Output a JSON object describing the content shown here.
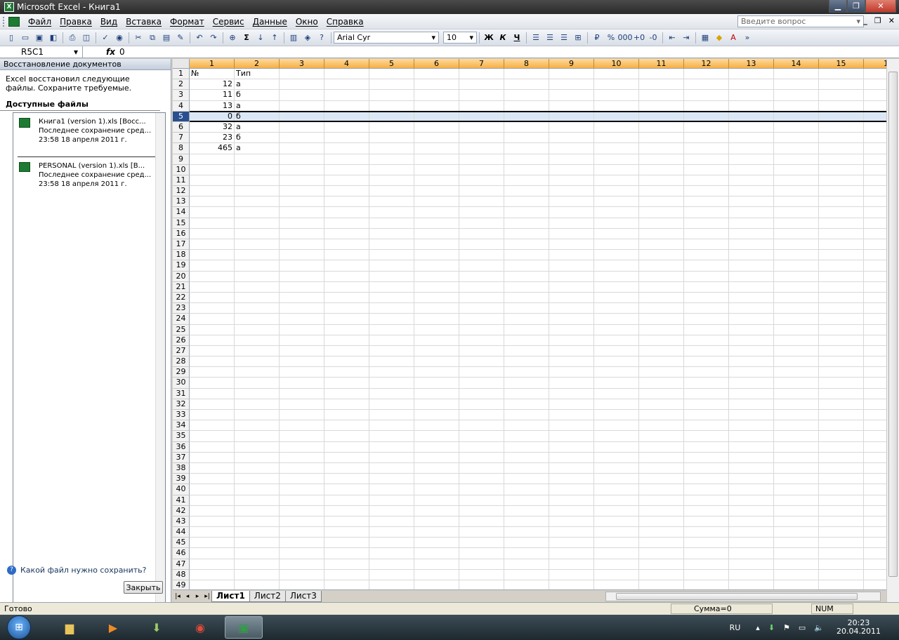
{
  "window": {
    "title": "Microsoft Excel - Книга1",
    "app_icon": "X"
  },
  "menu": {
    "items": [
      "Файл",
      "Правка",
      "Вид",
      "Вставка",
      "Формат",
      "Сервис",
      "Данные",
      "Окно",
      "Справка"
    ],
    "ask_placeholder": "Введите вопрос"
  },
  "toolbar": {
    "font": "Arial Cyr",
    "size": "10",
    "bold": "Ж",
    "italic": "К",
    "underline": "Ч"
  },
  "formula": {
    "cell_ref": "R5C1",
    "fx": "fx",
    "value": "0"
  },
  "taskpane": {
    "title": "Восстановление документов",
    "message": "Excel восстановил следующие файлы. Сохраните требуемые.",
    "available_label": "Доступные файлы",
    "files": [
      {
        "name": "Книга1 (version 1).xls  [Восс...",
        "saved": "Последнее сохранение сред...",
        "time": "23:58 18 апреля 2011 г."
      },
      {
        "name": "PERSONAL (version 1).xls  [В...",
        "saved": "Последнее сохранение сред...",
        "time": "23:58 18 апреля 2011 г."
      }
    ],
    "help_link": "Какой файл нужно сохранить?",
    "close_button": "Закрыть"
  },
  "sheet": {
    "columns": [
      "1",
      "2",
      "3",
      "4",
      "5",
      "6",
      "7",
      "8",
      "9",
      "10",
      "11",
      "12",
      "13",
      "14",
      "15",
      "1"
    ],
    "row_count": 49,
    "selected_row": 5,
    "cells": [
      {
        "row": 1,
        "c1": "№",
        "c2": "Тип"
      },
      {
        "row": 2,
        "c1": "12",
        "c2": "а"
      },
      {
        "row": 3,
        "c1": "11",
        "c2": "б"
      },
      {
        "row": 4,
        "c1": "13",
        "c2": "а"
      },
      {
        "row": 5,
        "c1": "0",
        "c2": "б"
      },
      {
        "row": 6,
        "c1": "32",
        "c2": "а"
      },
      {
        "row": 7,
        "c1": "23",
        "c2": "б"
      },
      {
        "row": 8,
        "c1": "465",
        "c2": "а"
      }
    ],
    "tabs": [
      "Лист1",
      "Лист2",
      "Лист3"
    ],
    "active_tab": "Лист1"
  },
  "status": {
    "ready": "Готово",
    "sum": "Сумма=0",
    "num": "NUM"
  },
  "taskbar": {
    "lang": "RU",
    "time": "20:23",
    "date": "20.04.2011"
  }
}
